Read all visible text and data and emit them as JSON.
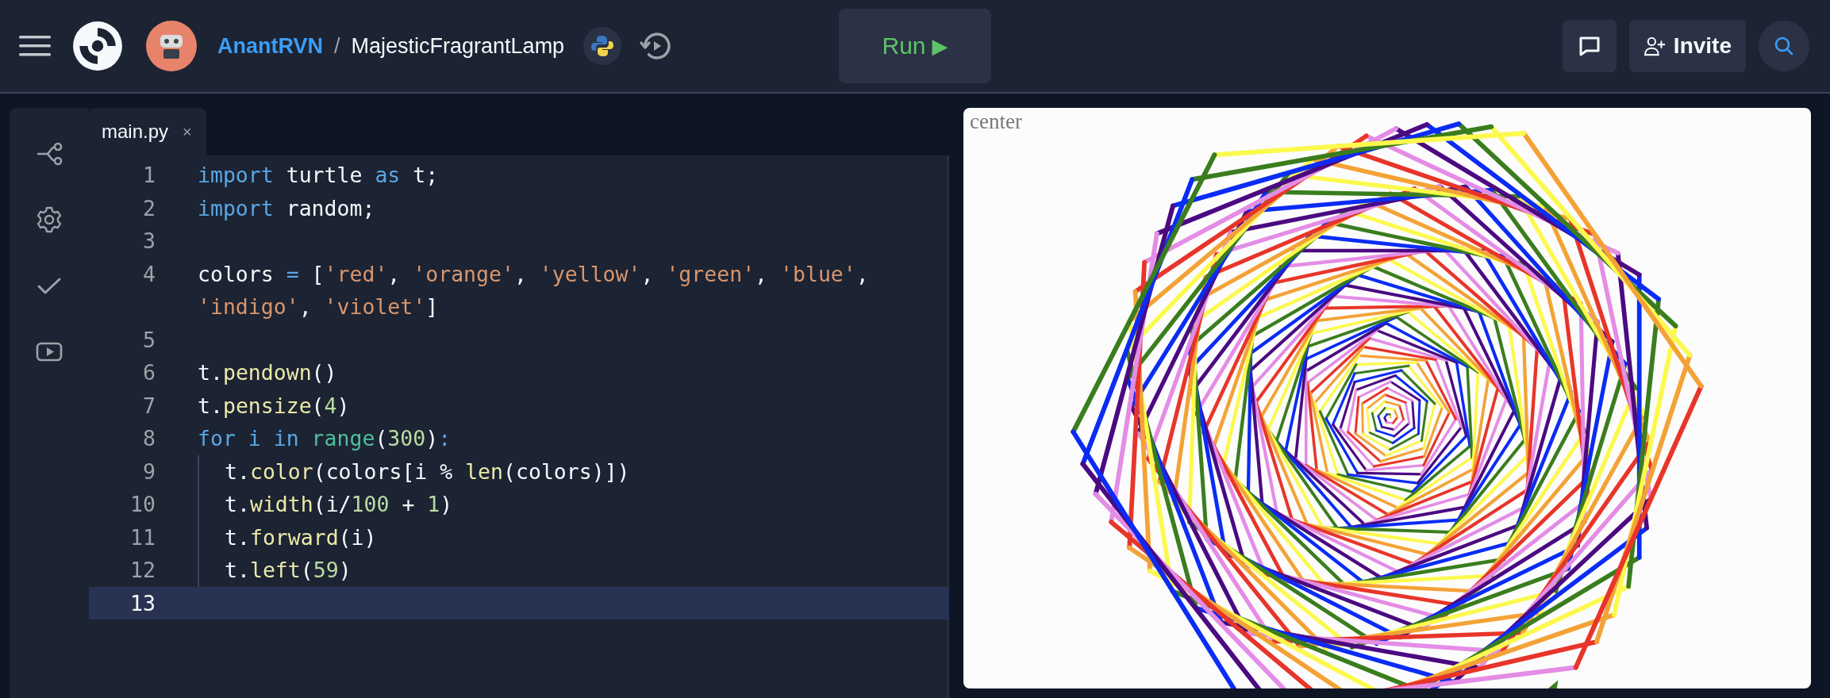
{
  "header": {
    "user": "AnantRVN",
    "separator": "/",
    "project": "MajesticFragrantLamp",
    "run_button": {
      "label": "Run",
      "icon": "▶"
    },
    "invite_button": "Invite"
  },
  "editor": {
    "tabs": [
      {
        "label": "main.py",
        "close": "×",
        "selected": true
      }
    ],
    "lines": [
      {
        "number": "1",
        "current": false,
        "indented": false,
        "rows": [
          {
            "tokens": [
              {
                "kind": "kw",
                "text": "import"
              },
              {
                "kind": "text",
                "text": " turtle "
              },
              {
                "kind": "kw",
                "text": "as"
              },
              {
                "kind": "text",
                "text": " t;"
              }
            ]
          }
        ]
      },
      {
        "number": "2",
        "current": false,
        "indented": false,
        "rows": [
          {
            "tokens": [
              {
                "kind": "kw",
                "text": "import"
              },
              {
                "kind": "text",
                "text": " random;"
              }
            ]
          }
        ]
      },
      {
        "number": "3",
        "current": false,
        "indented": false
      },
      {
        "number": "4",
        "current": false,
        "indented": false,
        "rows": [
          {
            "tokens": [
              {
                "kind": "text",
                "text": "colors "
              },
              {
                "kind": "op",
                "text": "="
              },
              {
                "kind": "text",
                "text": " ["
              },
              {
                "kind": "str",
                "text": "'red'"
              },
              {
                "kind": "text",
                "text": ", "
              },
              {
                "kind": "str",
                "text": "'orange'"
              },
              {
                "kind": "text",
                "text": ", "
              },
              {
                "kind": "str",
                "text": "'yellow'"
              },
              {
                "kind": "text",
                "text": ", "
              },
              {
                "kind": "str",
                "text": "'green'"
              },
              {
                "kind": "text",
                "text": ", "
              },
              {
                "kind": "str",
                "text": "'blue'"
              },
              {
                "kind": "text",
                "text": ","
              }
            ]
          },
          {
            "tokens": [
              {
                "kind": "str",
                "text": "'indigo'"
              },
              {
                "kind": "text",
                "text": ", "
              },
              {
                "kind": "str",
                "text": "'violet'"
              },
              {
                "kind": "text",
                "text": "]"
              }
            ]
          }
        ]
      },
      {
        "number": "5",
        "current": false,
        "indented": false
      },
      {
        "number": "6",
        "current": false,
        "indented": false,
        "rows": [
          {
            "tokens": [
              {
                "kind": "text",
                "text": "t."
              },
              {
                "kind": "fn",
                "text": "pendown"
              },
              {
                "kind": "text",
                "text": "()"
              }
            ]
          }
        ]
      },
      {
        "number": "7",
        "current": false,
        "indented": false,
        "rows": [
          {
            "tokens": [
              {
                "kind": "text",
                "text": "t."
              },
              {
                "kind": "fn",
                "text": "pensize"
              },
              {
                "kind": "text",
                "text": "("
              },
              {
                "kind": "num",
                "text": "4"
              },
              {
                "kind": "text",
                "text": ")"
              }
            ]
          }
        ]
      },
      {
        "number": "8",
        "current": false,
        "indented": false,
        "rows": [
          {
            "tokens": [
              {
                "kind": "kw",
                "text": "for i in "
              },
              {
                "kind": "bi",
                "text": "range"
              },
              {
                "kind": "text",
                "text": "("
              },
              {
                "kind": "num",
                "text": "300"
              },
              {
                "kind": "text",
                "text": ")"
              },
              {
                "kind": "kw",
                "text": ":"
              }
            ]
          }
        ]
      },
      {
        "number": "9",
        "current": false,
        "indented": true,
        "rows": [
          {
            "tokens": [
              {
                "kind": "text",
                "text": "t."
              },
              {
                "kind": "fn",
                "text": "color"
              },
              {
                "kind": "text",
                "text": "(colors[i % "
              },
              {
                "kind": "fn",
                "text": "len"
              },
              {
                "kind": "text",
                "text": "(colors)])"
              }
            ]
          }
        ]
      },
      {
        "number": "10",
        "current": false,
        "indented": true,
        "rows": [
          {
            "tokens": [
              {
                "kind": "text",
                "text": "t."
              },
              {
                "kind": "fn",
                "text": "width"
              },
              {
                "kind": "text",
                "text": "(i/"
              },
              {
                "kind": "num",
                "text": "100"
              },
              {
                "kind": "text",
                "text": " + "
              },
              {
                "kind": "num",
                "text": "1"
              },
              {
                "kind": "text",
                "text": ")"
              }
            ]
          }
        ]
      },
      {
        "number": "11",
        "current": false,
        "indented": true,
        "rows": [
          {
            "tokens": [
              {
                "kind": "text",
                "text": "t."
              },
              {
                "kind": "fn",
                "text": "forward"
              },
              {
                "kind": "text",
                "text": "(i)"
              }
            ]
          }
        ]
      },
      {
        "number": "12",
        "current": false,
        "indented": true,
        "rows": [
          {
            "tokens": [
              {
                "kind": "text",
                "text": "t."
              },
              {
                "kind": "fn",
                "text": "left"
              },
              {
                "kind": "text",
                "text": "("
              },
              {
                "kind": "num",
                "text": "59"
              },
              {
                "kind": "text",
                "text": ")"
              }
            ]
          }
        ]
      },
      {
        "number": "13",
        "current": true,
        "indented": false
      }
    ]
  },
  "output": {
    "label": "center"
  }
}
